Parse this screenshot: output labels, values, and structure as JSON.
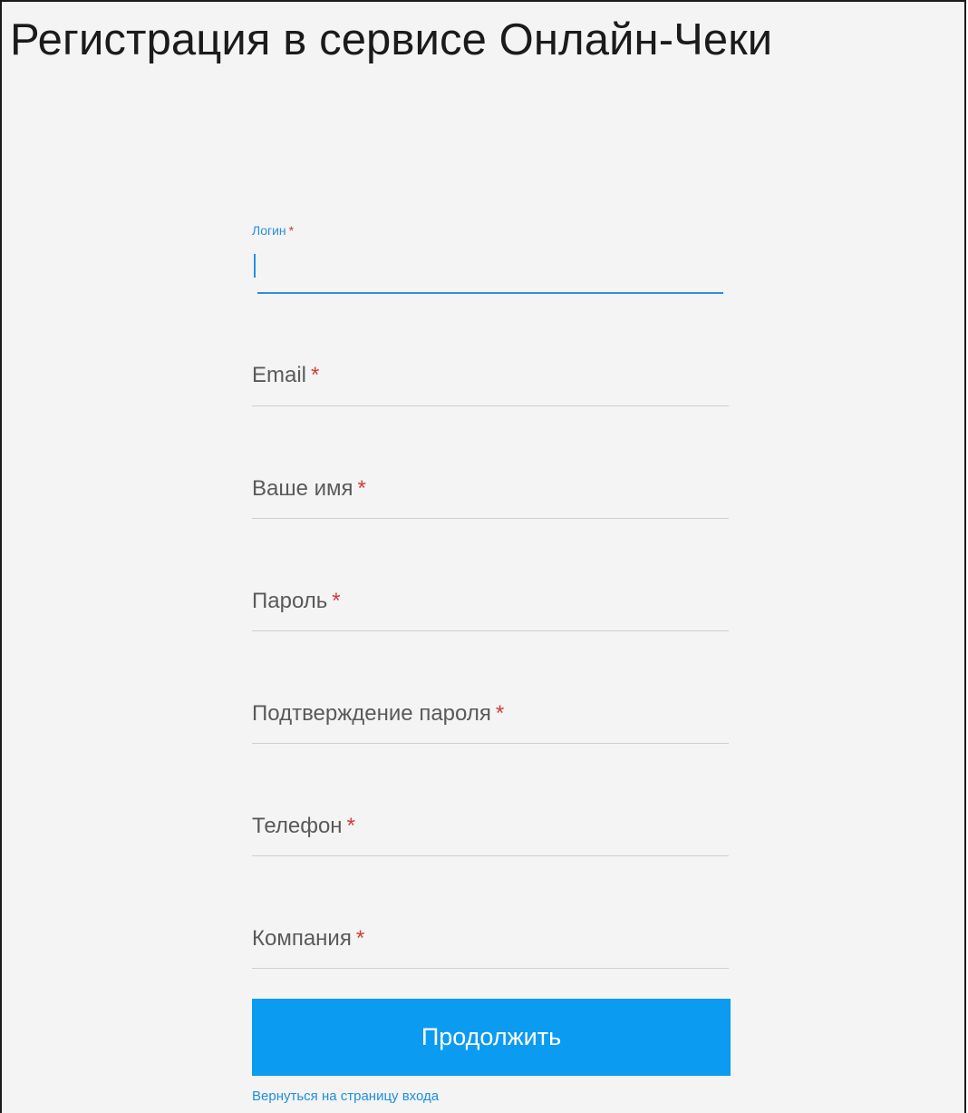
{
  "page": {
    "title": "Регистрация в сервисе Онлайн-Чеки"
  },
  "form": {
    "required_mark": "*",
    "fields": [
      {
        "label": "Логин",
        "value": "",
        "focused": true
      },
      {
        "label": "Email",
        "value": ""
      },
      {
        "label": "Ваше имя",
        "value": ""
      },
      {
        "label": "Пароль",
        "value": ""
      },
      {
        "label": "Подтверждение пароля",
        "value": ""
      },
      {
        "label": "Телефон",
        "value": ""
      },
      {
        "label": "Компания",
        "value": ""
      }
    ],
    "submit_label": "Продолжить",
    "back_link_label": "Вернуться на страницу входа"
  },
  "colors": {
    "accent": "#0b9bf0",
    "focus": "#2a8fe0",
    "required": "#d33a3a",
    "background": "#f4f4f4"
  }
}
